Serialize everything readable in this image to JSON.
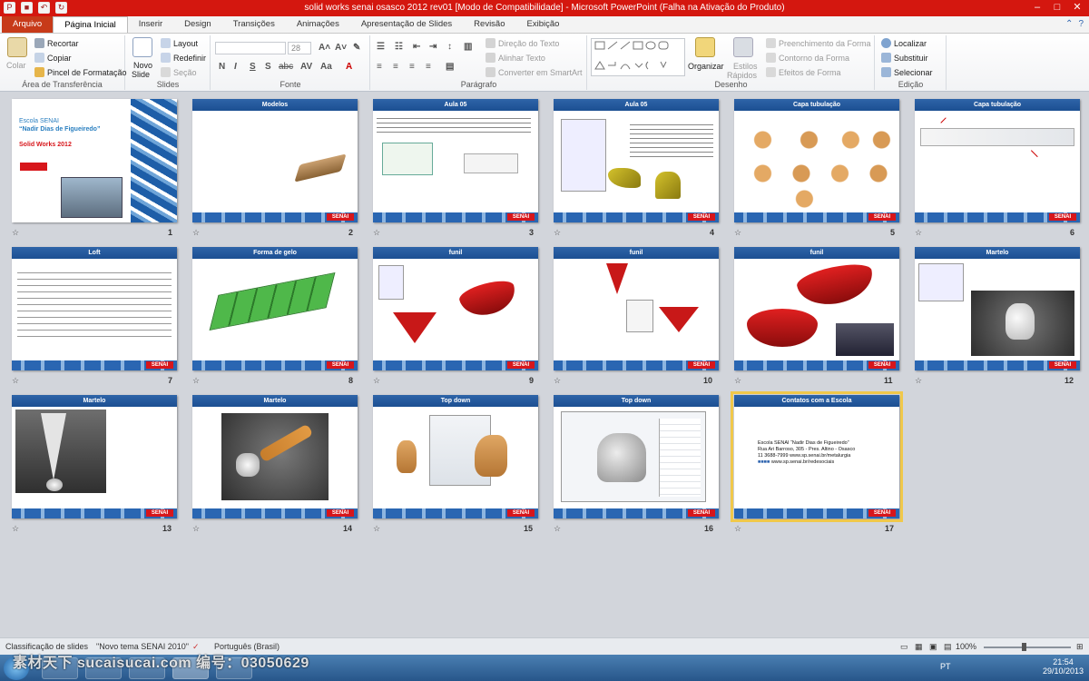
{
  "window": {
    "title": "solid works senai osasco 2012 rev01 [Modo de Compatibilidade]  -  Microsoft PowerPoint (Falha na Ativação do Produto)"
  },
  "tabs": [
    "Arquivo",
    "Página Inicial",
    "Inserir",
    "Design",
    "Transições",
    "Animações",
    "Apresentação de Slides",
    "Revisão",
    "Exibição"
  ],
  "ribbon": {
    "clipboard": {
      "colar": "Colar",
      "recortar": "Recortar",
      "copiar": "Copiar",
      "pincel": "Pincel de Formatação",
      "label": "Área de Transferência"
    },
    "slides": {
      "novo1": "Novo",
      "novo2": "Slide",
      "layout": "Layout",
      "redefinir": "Redefinir",
      "secao": "Seção",
      "label": "Slides"
    },
    "fonte": {
      "size": "28",
      "label": "Fonte"
    },
    "paragrafo": {
      "direcao": "Direção do Texto",
      "alinhar": "Alinhar Texto",
      "converter": "Converter em SmartArt",
      "label": "Parágrafo"
    },
    "desenho": {
      "organizar": "Organizar",
      "estilos1": "Estilos",
      "estilos2": "Rápidos",
      "preench": "Preenchimento da Forma",
      "contorno": "Contorno da Forma",
      "efeitos": "Efeitos de Forma",
      "label": "Desenho"
    },
    "edicao": {
      "localizar": "Localizar",
      "substituir": "Substituir",
      "selecionar": "Selecionar",
      "label": "Edição"
    }
  },
  "slides": [
    {
      "num": "1",
      "title": "",
      "lines": [
        "Escola SENAI",
        "“Nadir Dias de Figueiredo”",
        "Solid Works 2012"
      ]
    },
    {
      "num": "2",
      "title": "Modelos"
    },
    {
      "num": "3",
      "title": "Aula 05"
    },
    {
      "num": "4",
      "title": "Aula 05"
    },
    {
      "num": "5",
      "title": "Capa tubulação"
    },
    {
      "num": "6",
      "title": "Capa tubulação"
    },
    {
      "num": "7",
      "title": "Loft"
    },
    {
      "num": "8",
      "title": "Forma de gelo"
    },
    {
      "num": "9",
      "title": "funil"
    },
    {
      "num": "10",
      "title": "funil"
    },
    {
      "num": "11",
      "title": "funil"
    },
    {
      "num": "12",
      "title": "Martelo"
    },
    {
      "num": "13",
      "title": "Martelo"
    },
    {
      "num": "14",
      "title": "Martelo"
    },
    {
      "num": "15",
      "title": "Top down"
    },
    {
      "num": "16",
      "title": "Top down"
    },
    {
      "num": "17",
      "title": "Contatos com a Escola",
      "lines": [
        "Escola SENAI “Nadir Dias de Figueiredo”",
        "Rua Ari Barroso,  305  - Pres. Altino - Osasco",
        "11   3688-7999   www.sp.senai.br/metalurgia",
        "www.sp.senai.br/redesociais"
      ]
    }
  ],
  "logo": "SENAI",
  "status": {
    "tab": "Classificação de slides",
    "theme": "\"Novo tema SENAI 2010\"",
    "lang": "Português (Brasil)",
    "zoom": "100%"
  },
  "taskbar": {
    "time": "21:54",
    "date": "29/10/2013",
    "lang": "PT"
  },
  "watermark": "素材天下 sucaisucai.com   编号：03050629",
  "colors": {
    "titlebar": "#d4170f",
    "header": "#1c4f92",
    "selection": "#f0c84a"
  }
}
